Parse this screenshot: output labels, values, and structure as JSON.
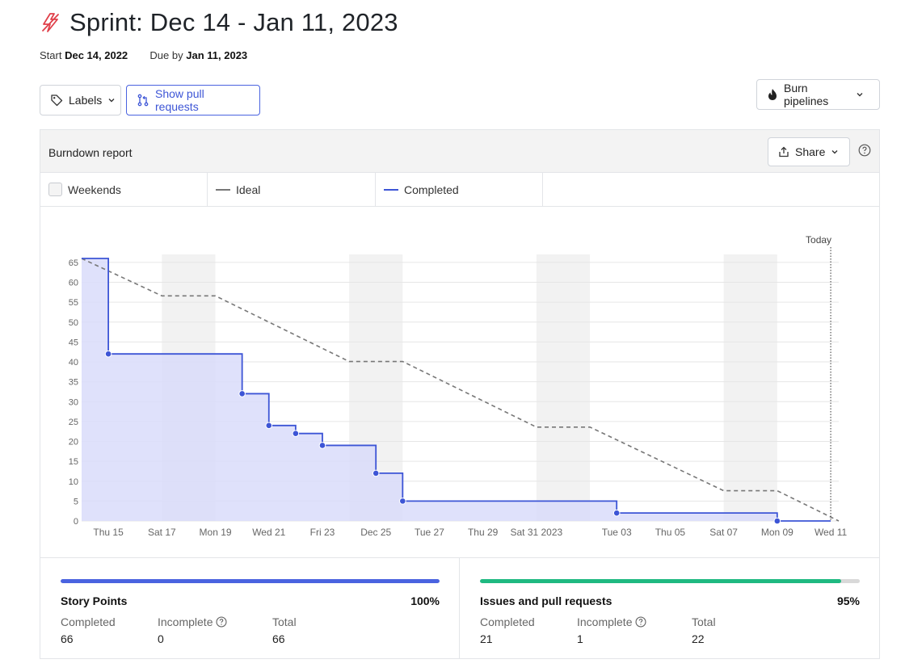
{
  "header": {
    "title": "Sprint: Dec 14 - Jan 11, 2023",
    "start_label": "Start",
    "start_value": "Dec 14, 2022",
    "due_label": "Due by",
    "due_value": "Jan 11, 2023",
    "icon": "lightning-icon"
  },
  "toolbar": {
    "labels_button": "Labels",
    "pulls_button": "Show pull requests",
    "burn_button": "Burn pipelines"
  },
  "report": {
    "title": "Burndown report",
    "share_button": "Share",
    "legend": {
      "weekends": "Weekends",
      "ideal": "Ideal",
      "completed": "Completed"
    }
  },
  "colors": {
    "accent": "#4a63e0",
    "completed_line": "#3d55d6",
    "completed_fill": "#d9dcfa",
    "ideal_line": "#777777",
    "weekend_band": "#f2f2f2",
    "issues_bar": "#1fb981",
    "title_icon": "#e0414b"
  },
  "chart_data": {
    "type": "area",
    "x_tick_labels": [
      "Thu 15",
      "Sat 17",
      "Mon 19",
      "Wed 21",
      "Fri 23",
      "Dec 25",
      "Tue 27",
      "Thu 29",
      "Sat 31 2023",
      "Tue 03",
      "Thu 05",
      "Sat 07",
      "Mon 09",
      "Wed 11"
    ],
    "x_tick_days": [
      1,
      3,
      5,
      7,
      9,
      11,
      13,
      15,
      17,
      20,
      22,
      24,
      26,
      28
    ],
    "x_range_days": [
      0,
      28.3
    ],
    "x_day_zero": "Dec 14",
    "yticks": [
      0,
      5,
      10,
      15,
      20,
      25,
      30,
      35,
      40,
      45,
      50,
      55,
      60,
      65
    ],
    "ylim": [
      0,
      66
    ],
    "grid": true,
    "today_label": "Today",
    "today_day": 28,
    "weekend_bands_days": [
      [
        3,
        5
      ],
      [
        10,
        12
      ],
      [
        17,
        19
      ],
      [
        24,
        26
      ]
    ],
    "series": [
      {
        "name": "Ideal",
        "style": "dashed",
        "points": [
          [
            0,
            66
          ],
          [
            3,
            56.6
          ],
          [
            5,
            56.6
          ],
          [
            10,
            40.1
          ],
          [
            12,
            40.1
          ],
          [
            17,
            23.6
          ],
          [
            19,
            23.6
          ],
          [
            24,
            7.6
          ],
          [
            26,
            7.6
          ],
          [
            28.3,
            0
          ]
        ]
      },
      {
        "name": "Completed",
        "style": "step",
        "points": [
          [
            0,
            66
          ],
          [
            1,
            42
          ],
          [
            6,
            32
          ],
          [
            7,
            24
          ],
          [
            8,
            22
          ],
          [
            9,
            19
          ],
          [
            11,
            12
          ],
          [
            12,
            5
          ],
          [
            20,
            2
          ],
          [
            26,
            0
          ],
          [
            28,
            0
          ]
        ]
      }
    ]
  },
  "stats": {
    "story_points": {
      "name": "Story Points",
      "percent": "100%",
      "progress": 1.0,
      "completed_label": "Completed",
      "completed_value": "66",
      "incomplete_label": "Incomplete",
      "incomplete_value": "0",
      "total_label": "Total",
      "total_value": "66"
    },
    "issues": {
      "name": "Issues and pull requests",
      "percent": "95%",
      "progress": 0.95,
      "completed_label": "Completed",
      "completed_value": "21",
      "incomplete_label": "Incomplete",
      "incomplete_value": "1",
      "total_label": "Total",
      "total_value": "22"
    }
  }
}
